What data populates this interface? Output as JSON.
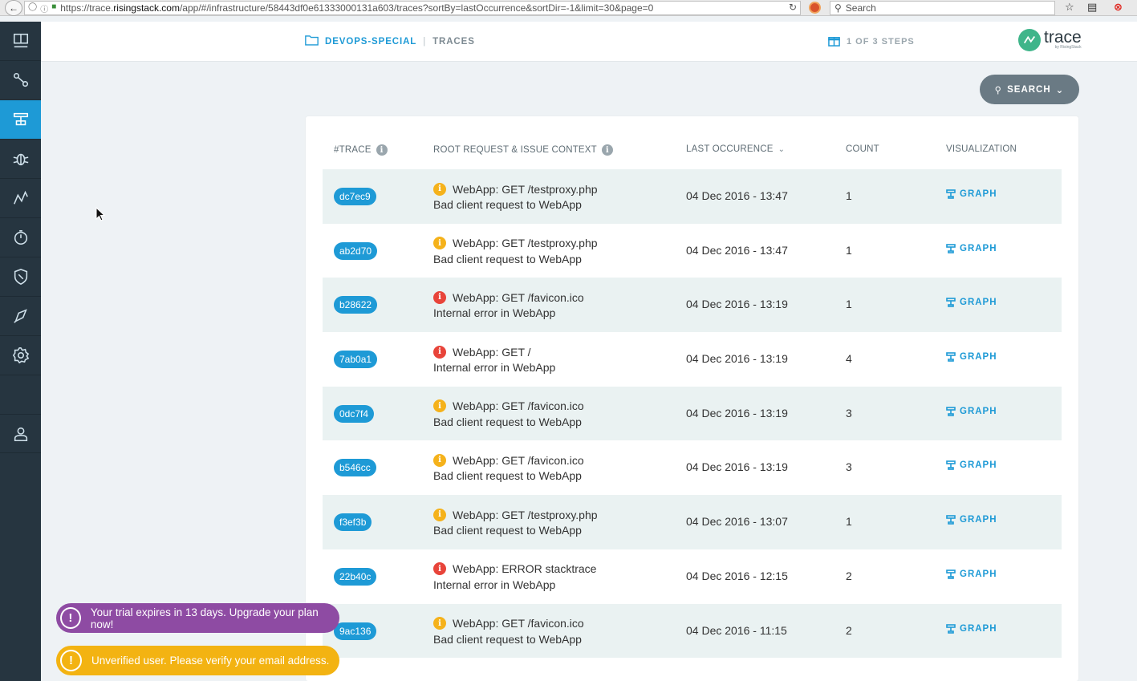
{
  "browser": {
    "url_prefix": "https://trace.",
    "url_domain": "risingstack.com",
    "url_suffix": "/app/#/infrastructure/58443df0e61333000131a603/traces?sortBy=lastOccurrence&sortDir=-1&limit=30&page=0",
    "search_placeholder": "Search"
  },
  "header": {
    "project": "DEVOPS-SPECIAL",
    "separator": "|",
    "page": "TRACES",
    "steps": "1 OF 3 STEPS",
    "brand": "trace",
    "brand_sub": "by RisingStack"
  },
  "search_button": {
    "label": "SEARCH"
  },
  "table": {
    "columns": {
      "trace": "#TRACE",
      "context": "ROOT REQUEST & ISSUE CONTEXT",
      "last": "LAST OCCURENCE",
      "count": "COUNT",
      "viz": "VISUALIZATION"
    },
    "rows": [
      {
        "id": "dc7ec9",
        "level": "warn",
        "request": "WebApp:  GET /testproxy.php",
        "issue": "Bad client request to WebApp",
        "date": "04 Dec 2016 - 13:47",
        "count": "1",
        "viz": "GRAPH"
      },
      {
        "id": "ab2d70",
        "level": "warn",
        "request": "WebApp:  GET /testproxy.php",
        "issue": "Bad client request to WebApp",
        "date": "04 Dec 2016 - 13:47",
        "count": "1",
        "viz": "GRAPH"
      },
      {
        "id": "b28622",
        "level": "error",
        "request": "WebApp:  GET /favicon.ico",
        "issue": "Internal error in WebApp",
        "date": "04 Dec 2016 - 13:19",
        "count": "1",
        "viz": "GRAPH"
      },
      {
        "id": "7ab0a1",
        "level": "error",
        "request": "WebApp:  GET /",
        "issue": "Internal error in WebApp",
        "date": "04 Dec 2016 - 13:19",
        "count": "4",
        "viz": "GRAPH"
      },
      {
        "id": "0dc7f4",
        "level": "warn",
        "request": "WebApp:  GET /favicon.ico",
        "issue": "Bad client request to WebApp",
        "date": "04 Dec 2016 - 13:19",
        "count": "3",
        "viz": "GRAPH"
      },
      {
        "id": "b546cc",
        "level": "warn",
        "request": "WebApp:  GET /favicon.ico",
        "issue": "Bad client request to WebApp",
        "date": "04 Dec 2016 - 13:19",
        "count": "3",
        "viz": "GRAPH"
      },
      {
        "id": "f3ef3b",
        "level": "warn",
        "request": "WebApp:  GET /testproxy.php",
        "issue": "Bad client request to WebApp",
        "date": "04 Dec 2016 - 13:07",
        "count": "1",
        "viz": "GRAPH"
      },
      {
        "id": "22b40c",
        "level": "error",
        "request": "WebApp:  ERROR stacktrace",
        "issue": "Internal error in WebApp",
        "date": "04 Dec 2016 - 12:15",
        "count": "2",
        "viz": "GRAPH"
      },
      {
        "id": "9ac136",
        "level": "warn",
        "request": "WebApp:  GET /favicon.ico",
        "issue": "Bad client request to WebApp",
        "date": "04 Dec 2016 - 11:15",
        "count": "2",
        "viz": "GRAPH"
      }
    ]
  },
  "toasts": {
    "trial": "Your trial expires in 13 days. Upgrade your plan now!",
    "verify": "Unverified user. Please verify your email address.",
    "icon_glyph": "!"
  },
  "icons": {
    "info_glyph": "i",
    "sidebar": [
      "dashboard-icon",
      "topology-icon",
      "traces-icon",
      "bug-icon",
      "metrics-icon",
      "profiler-icon",
      "security-icon",
      "alerts-icon",
      "settings-icon",
      "user-icon"
    ]
  },
  "colors": {
    "accent": "#1e9ad6",
    "sidebar": "#263540",
    "warn": "#f5b21b",
    "error": "#e8443a",
    "trial_toast": "#8e4ba3",
    "verify_toast": "#f3b312"
  }
}
